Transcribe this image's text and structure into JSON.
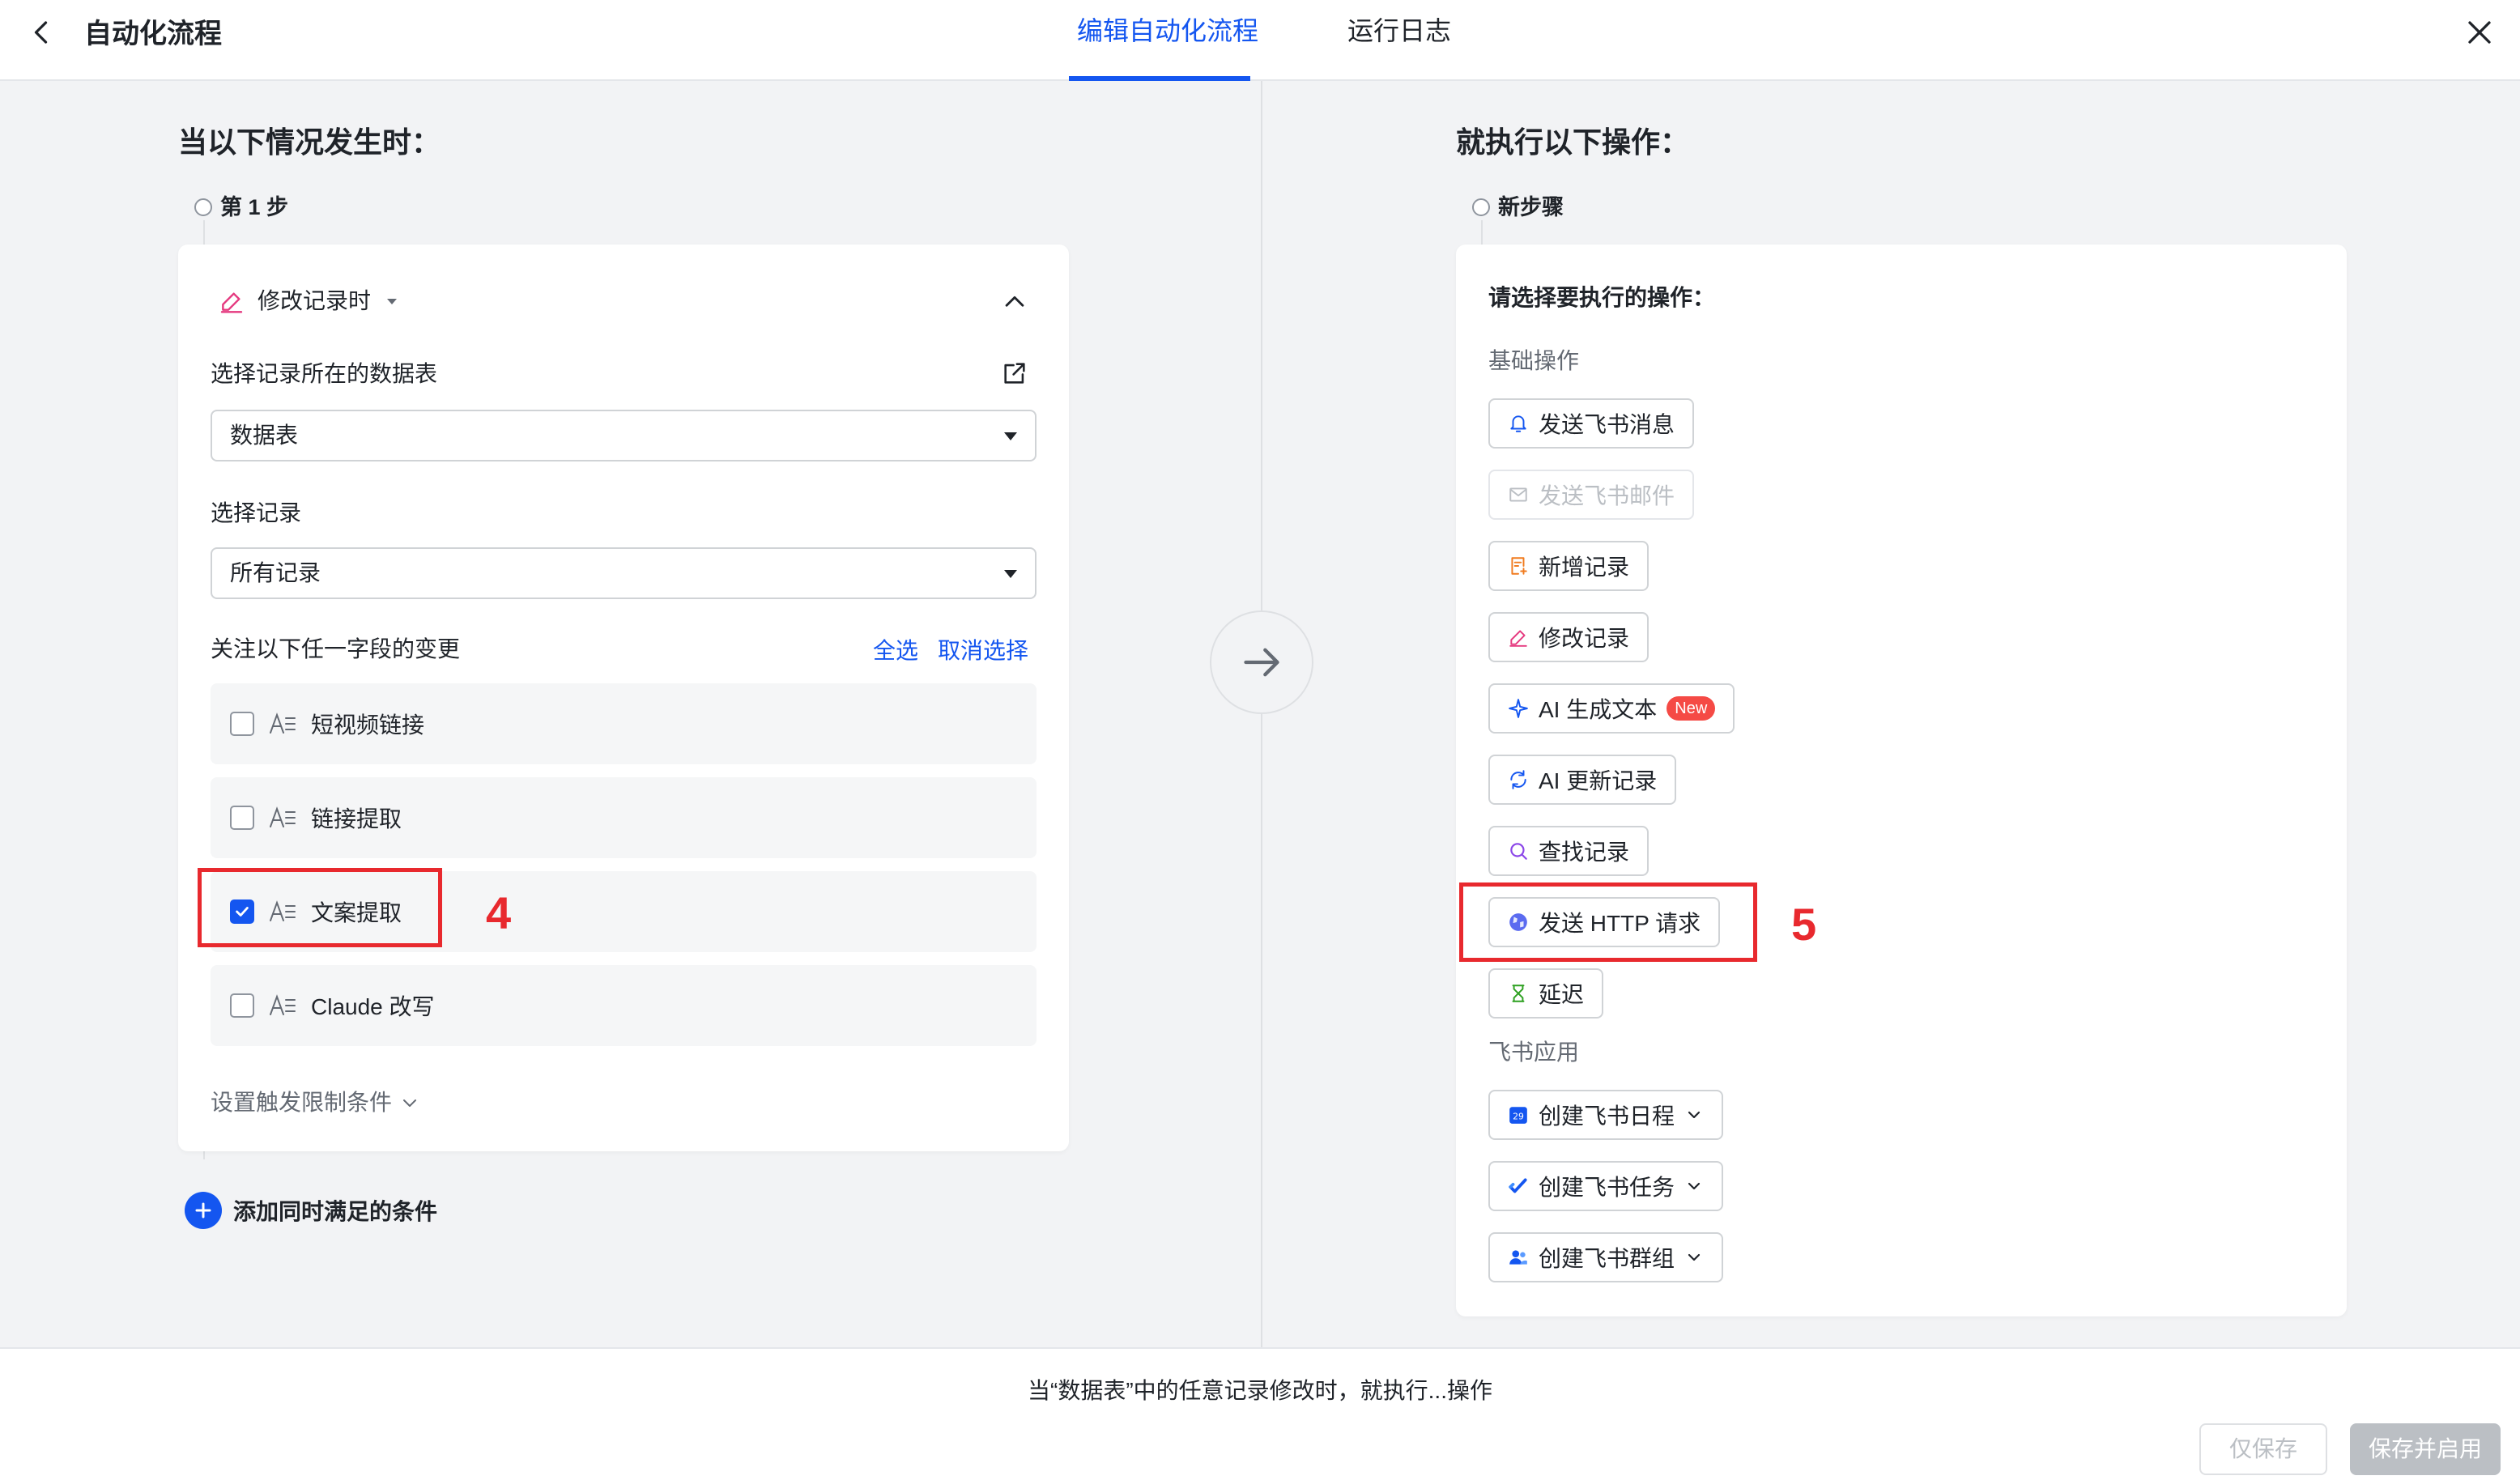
{
  "header": {
    "title": "自动化流程",
    "tabs": [
      {
        "label": "编辑自动化流程",
        "active": true
      },
      {
        "label": "运行日志",
        "active": false
      }
    ]
  },
  "trigger": {
    "section_title": "当以下情况发生时：",
    "step_label": "第 1 步",
    "event_label": "修改记录时",
    "table_label": "选择记录所在的数据表",
    "table_value": "数据表",
    "record_label": "选择记录",
    "record_value": "所有记录",
    "watch_label": "关注以下任一字段的变更",
    "select_all": "全选",
    "deselect": "取消选择",
    "fields": [
      {
        "label": "短视频链接",
        "checked": false
      },
      {
        "label": "链接提取",
        "checked": false
      },
      {
        "label": "文案提取",
        "checked": true
      },
      {
        "label": "Claude 改写",
        "checked": false
      }
    ],
    "limit_label": "设置触发限制条件",
    "add_condition": "添加同时满足的条件"
  },
  "action": {
    "section_title": "就执行以下操作：",
    "step_label": "新步骤",
    "prompt": "请选择要执行的操作：",
    "basic_group": "基础操作",
    "basic_ops": [
      {
        "label": "发送飞书消息",
        "icon": "bell-icon",
        "disabled": false
      },
      {
        "label": "发送飞书邮件",
        "icon": "mail-icon",
        "disabled": true
      },
      {
        "label": "新增记录",
        "icon": "add-record-icon",
        "disabled": false
      },
      {
        "label": "修改记录",
        "icon": "pencil-icon",
        "disabled": false
      },
      {
        "label": "AI 生成文本",
        "icon": "sparkle-icon",
        "disabled": false,
        "badge": "New"
      },
      {
        "label": "AI 更新记录",
        "icon": "refresh-icon",
        "disabled": false
      },
      {
        "label": "查找记录",
        "icon": "search-icon",
        "disabled": false
      },
      {
        "label": "发送 HTTP 请求",
        "icon": "globe-icon",
        "disabled": false
      },
      {
        "label": "延迟",
        "icon": "hourglass-icon",
        "disabled": false
      }
    ],
    "app_group": "飞书应用",
    "app_ops": [
      {
        "label": "创建飞书日程",
        "icon": "calendar-icon",
        "calendar_day": "29"
      },
      {
        "label": "创建飞书任务",
        "icon": "task-check-icon"
      },
      {
        "label": "创建飞书群组",
        "icon": "group-icon"
      }
    ]
  },
  "annotations": [
    "4",
    "5"
  ],
  "footer": {
    "summary": "当“数据表”中的任意记录修改时，就执行...操作",
    "save_only": "仅保存",
    "save_enable": "保存并启用"
  },
  "colors": {
    "accent": "#1456f0",
    "annotation_red": "#e8292e",
    "disabled": "#bbbfc4"
  }
}
